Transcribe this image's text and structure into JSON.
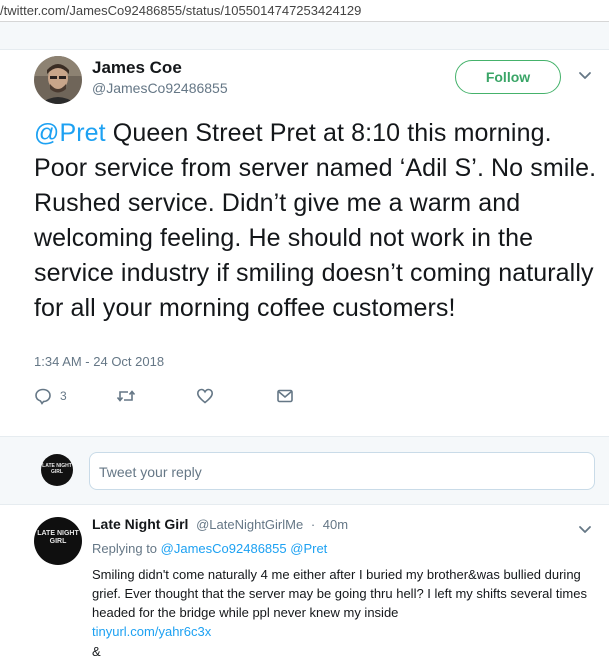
{
  "browser": {
    "url": "/twitter.com/JamesCo92486855/status/1055014747253424129"
  },
  "tweet": {
    "author_name": "James Coe",
    "author_handle": "@JamesCo92486855",
    "follow_label": "Follow",
    "mention": "@Pret",
    "text": " Queen Street Pret at 8:10 this morning. Poor service from server named ‘Adil S’. No smile. Rushed service. Didn’t give me a warm and welcoming feeling. He should not work in the service industry if smiling doesn’t coming naturally for all your morning coffee customers!",
    "timestamp": "1:34 AM - 24 Oct 2018",
    "reply_count": "3",
    "icons": [
      "reply-icon",
      "retweet-icon",
      "like-icon",
      "message-icon",
      "chevron-down-icon"
    ]
  },
  "reply_composer": {
    "avatar_text": "LATE NIGHT GIRL",
    "placeholder": "Tweet your reply"
  },
  "reply": {
    "avatar_text": "LATE NIGHT GIRL",
    "author_name": "Late Night Girl",
    "author_handle": "@LateNightGirlMe",
    "separator": "·",
    "time_ago": "40m",
    "replying_prefix": "Replying to",
    "replying_to_1": "@JamesCo92486855",
    "replying_to_2": "@Pret",
    "text": "Smiling didn't come naturally 4 me either after I buried my brother&was bullied during grief. Ever thought that the server may be going thru hell? I left my shifts several times headed for the bridge while ppl never knew my inside",
    "link": "tinyurl.com/yahr6c3x",
    "trailing": "&"
  },
  "colors": {
    "accent_blue": "#1da1f2",
    "follow_green": "#3aa567",
    "secondary_text": "#657786",
    "background_light": "#f5f8fa"
  }
}
